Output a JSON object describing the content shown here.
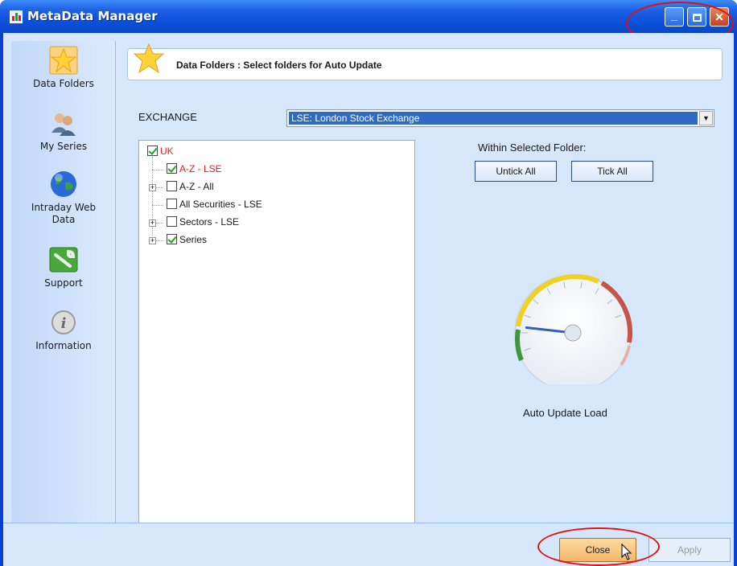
{
  "window": {
    "title": "MetaData Manager",
    "controls": [
      "minimize",
      "maximize",
      "close"
    ]
  },
  "sidebar": {
    "items": [
      {
        "label": "Data Folders",
        "icon": "star-icon"
      },
      {
        "label": "My Series",
        "icon": "users-icon"
      },
      {
        "label": "Intraday Web Data",
        "icon": "globe-icon"
      },
      {
        "label": "Support",
        "icon": "wrench-icon"
      },
      {
        "label": "Information",
        "icon": "info-icon"
      }
    ]
  },
  "header": {
    "title": "Data Folders : Select folders for Auto Update"
  },
  "exchange": {
    "label": "EXCHANGE",
    "selected": "LSE: London Stock Exchange"
  },
  "tree": {
    "root": {
      "label": "UK",
      "checked": true
    },
    "children": [
      {
        "label": "A-Z - LSE",
        "checked": true,
        "expandable": false
      },
      {
        "label": "A-Z - All",
        "checked": false,
        "expandable": true
      },
      {
        "label": "All Securities - LSE",
        "checked": false,
        "expandable": false
      },
      {
        "label": "Sectors - LSE",
        "checked": false,
        "expandable": true
      },
      {
        "label": "Series",
        "checked": true,
        "expandable": true
      }
    ]
  },
  "folder_actions": {
    "heading": "Within Selected Folder:",
    "untick_label": "Untick All",
    "tick_label": "Tick All"
  },
  "gauge": {
    "label": "Auto Update Load",
    "value_fraction": 0.12
  },
  "footer": {
    "close_label": "Close",
    "apply_label": "Apply"
  },
  "colors": {
    "title_bar": "#0b4fd8",
    "client_bg": "#d6e6fb",
    "selection": "#316ac5",
    "highlight_red": "#e02020",
    "close_button": "#f3b56a"
  }
}
